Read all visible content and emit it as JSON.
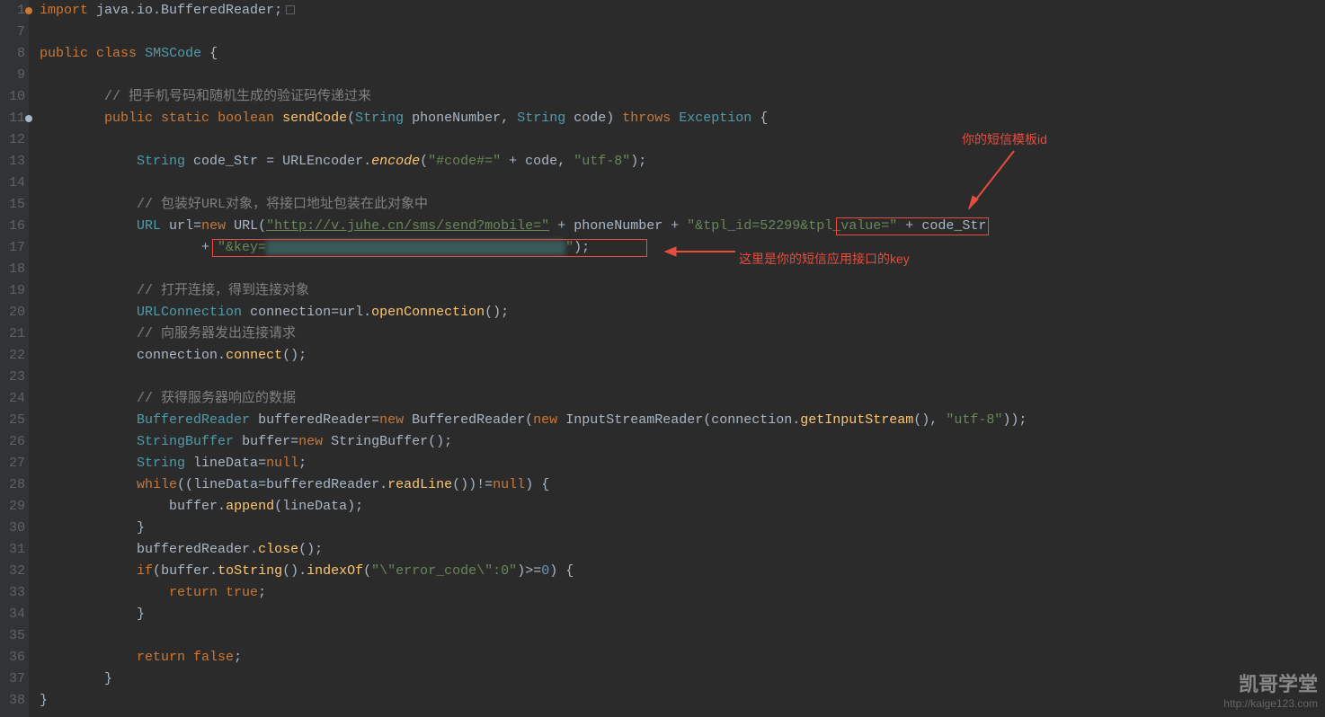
{
  "gutter": {
    "start": 1,
    "end": 38
  },
  "code": {
    "ln1": {
      "import": "import",
      "pkg": "java.io.BufferedReader",
      "semi": ";"
    },
    "ln8": {
      "pub": "public",
      "cls": "class",
      "name": "SMSCode",
      "brace": " {"
    },
    "ln10": {
      "comment": "// 把手机号码和随机生成的验证码传递过来"
    },
    "ln11": {
      "pub": "public",
      "static": "static",
      "bool": "boolean",
      "method": "sendCode",
      "open": "(",
      "type1": "String",
      "p1": " phoneNumber",
      "comma": ", ",
      "type2": "String",
      "p2": " code",
      "close": ") ",
      "throws": "throws",
      "exc": " Exception ",
      "brace": "{"
    },
    "ln13": {
      "type": "String",
      "var": " code_Str ",
      "eq": "= ",
      "cls": "URLEncoder",
      "dot": ".",
      "enc": "encode",
      "open": "(",
      "str1": "\"#code#=\"",
      "plus": " + ",
      "code": "code",
      "c2": ", ",
      "str2": "\"utf-8\"",
      "close": ");"
    },
    "ln15": {
      "comment": "// 包装好URL对象，将接口地址包装在此对象中"
    },
    "ln16": {
      "type": "URL",
      "var": " url",
      "eq": "=",
      "new": "new ",
      "cls": "URL",
      "open": "(",
      "str1": "\"http://v.juhe.cn/sms/send?mobile=\"",
      "plus1": " + ",
      "pn": "phoneNumber",
      "plus2": " + ",
      "str2": "\"&tpl_id=52299&tpl_value=\"",
      "plus3": " + ",
      "cs": "code_Str"
    },
    "ln17": {
      "plus": "+ ",
      "str": "\"&key=",
      "blur": "                                     ",
      "strend": "\"",
      "close": ");"
    },
    "ln19": {
      "comment": "// 打开连接，得到连接对象"
    },
    "ln20": {
      "type": "URLConnection",
      "var": " connection",
      "eq": "=",
      "url": "url",
      "dot": ".",
      "method": "openConnection",
      "close": "();"
    },
    "ln21": {
      "comment": "// 向服务器发出连接请求"
    },
    "ln22": {
      "conn": "connection",
      "dot": ".",
      "method": "connect",
      "close": "();"
    },
    "ln24": {
      "comment": "// 获得服务器响应的数据"
    },
    "ln25": {
      "type": "BufferedReader",
      "var": " bufferedReader",
      "eq": "=",
      "new": "new ",
      "cls": "BufferedReader",
      "open": "(",
      "new2": "new ",
      "cls2": "InputStreamReader",
      "open2": "(",
      "conn": "connection",
      "dot": ".",
      "method": "getInputStream",
      "p": "(), ",
      "str": "\"utf-8\"",
      "close": "));"
    },
    "ln26": {
      "type": "StringBuffer",
      "var": " buffer",
      "eq": "=",
      "new": "new ",
      "cls": "StringBuffer",
      "close": "();"
    },
    "ln27": {
      "type": "String",
      "var": " lineData",
      "eq": "=",
      "null": "null",
      "semi": ";"
    },
    "ln28": {
      "while": "while",
      "open": "((",
      "ld": "lineData",
      "eq": "=",
      "br": "bufferedReader",
      "dot": ".",
      "rl": "readLine",
      "p": "())!=",
      "null": "null",
      "close": ") {"
    },
    "ln29": {
      "buf": "buffer",
      "dot": ".",
      "app": "append",
      "open": "(",
      "ld": "lineData",
      "close": ");"
    },
    "ln30": {
      "brace": "}"
    },
    "ln31": {
      "br": "bufferedReader",
      "dot": ".",
      "close": "close",
      "p": "();"
    },
    "ln32": {
      "if": "if",
      "open": "(",
      "buf": "buffer",
      "dot1": ".",
      "ts": "toString",
      "p1": "().",
      "io": "indexOf",
      "open2": "(",
      "str": "\"\\\"error_code\\\":0\"",
      "close2": ")>=",
      "zero": "0",
      "close": ") {"
    },
    "ln33": {
      "ret": "return",
      "true": " true",
      "semi": ";"
    },
    "ln34": {
      "brace": "}"
    },
    "ln36": {
      "ret": "return",
      "false": " false",
      "semi": ";"
    },
    "ln37": {
      "brace": "}"
    },
    "ln38": {
      "brace": "}"
    }
  },
  "annotations": {
    "tpl_id": "你的短信模板id",
    "key": "这里是你的短信应用接口的key"
  },
  "watermark": {
    "title": "凯哥学堂",
    "url": "http://kaige123.com"
  }
}
